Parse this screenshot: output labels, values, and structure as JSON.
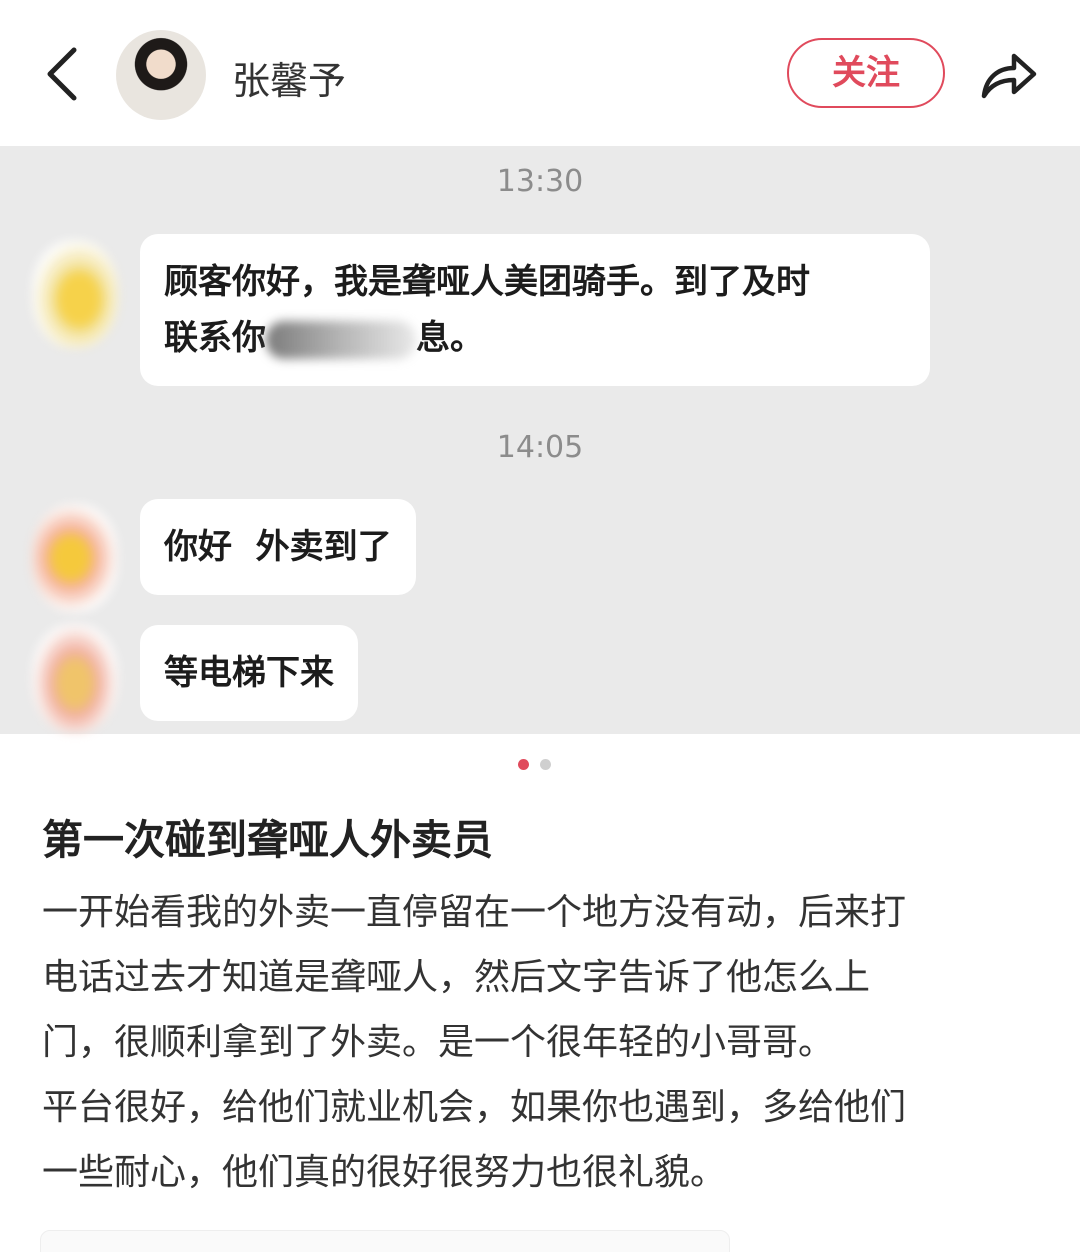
{
  "header": {
    "author_name": "张馨予",
    "follow_label": "关注"
  },
  "chat": {
    "time_1": "13:30",
    "msg_1_line_1": "顾客你好，我是聋哑人美团骑手。到了及时",
    "msg_1_line_2_start": "联系你",
    "msg_1_line_2_end": "息。",
    "time_2": "14:05",
    "msg_2": "你好  外卖到了",
    "msg_3": "等电梯下来"
  },
  "carousel": {
    "active_color": "#e04a5c",
    "inactive_color": "#cfcfcf"
  },
  "note": {
    "title": "第一次碰到聋哑人外卖员",
    "body_lines": [
      "一开始看我的外卖一直停留在一个地方没有动，后来打",
      "电话过去才知道是聋哑人，然后文字告诉了他怎么上",
      "门，很顺利拿到了外卖。是一个很年轻的小哥哥。",
      "平台很好，给他们就业机会，如果你也遇到，多给他们",
      "一些耐心，他们真的很好很努力也很礼貌。"
    ]
  },
  "colors": {
    "brand": "#e04a5c",
    "chat_bg": "#eaeaea",
    "timestamp": "#8c8c8c"
  },
  "icons": {
    "back": "chevron-left-icon",
    "share": "share-arrow-icon"
  }
}
